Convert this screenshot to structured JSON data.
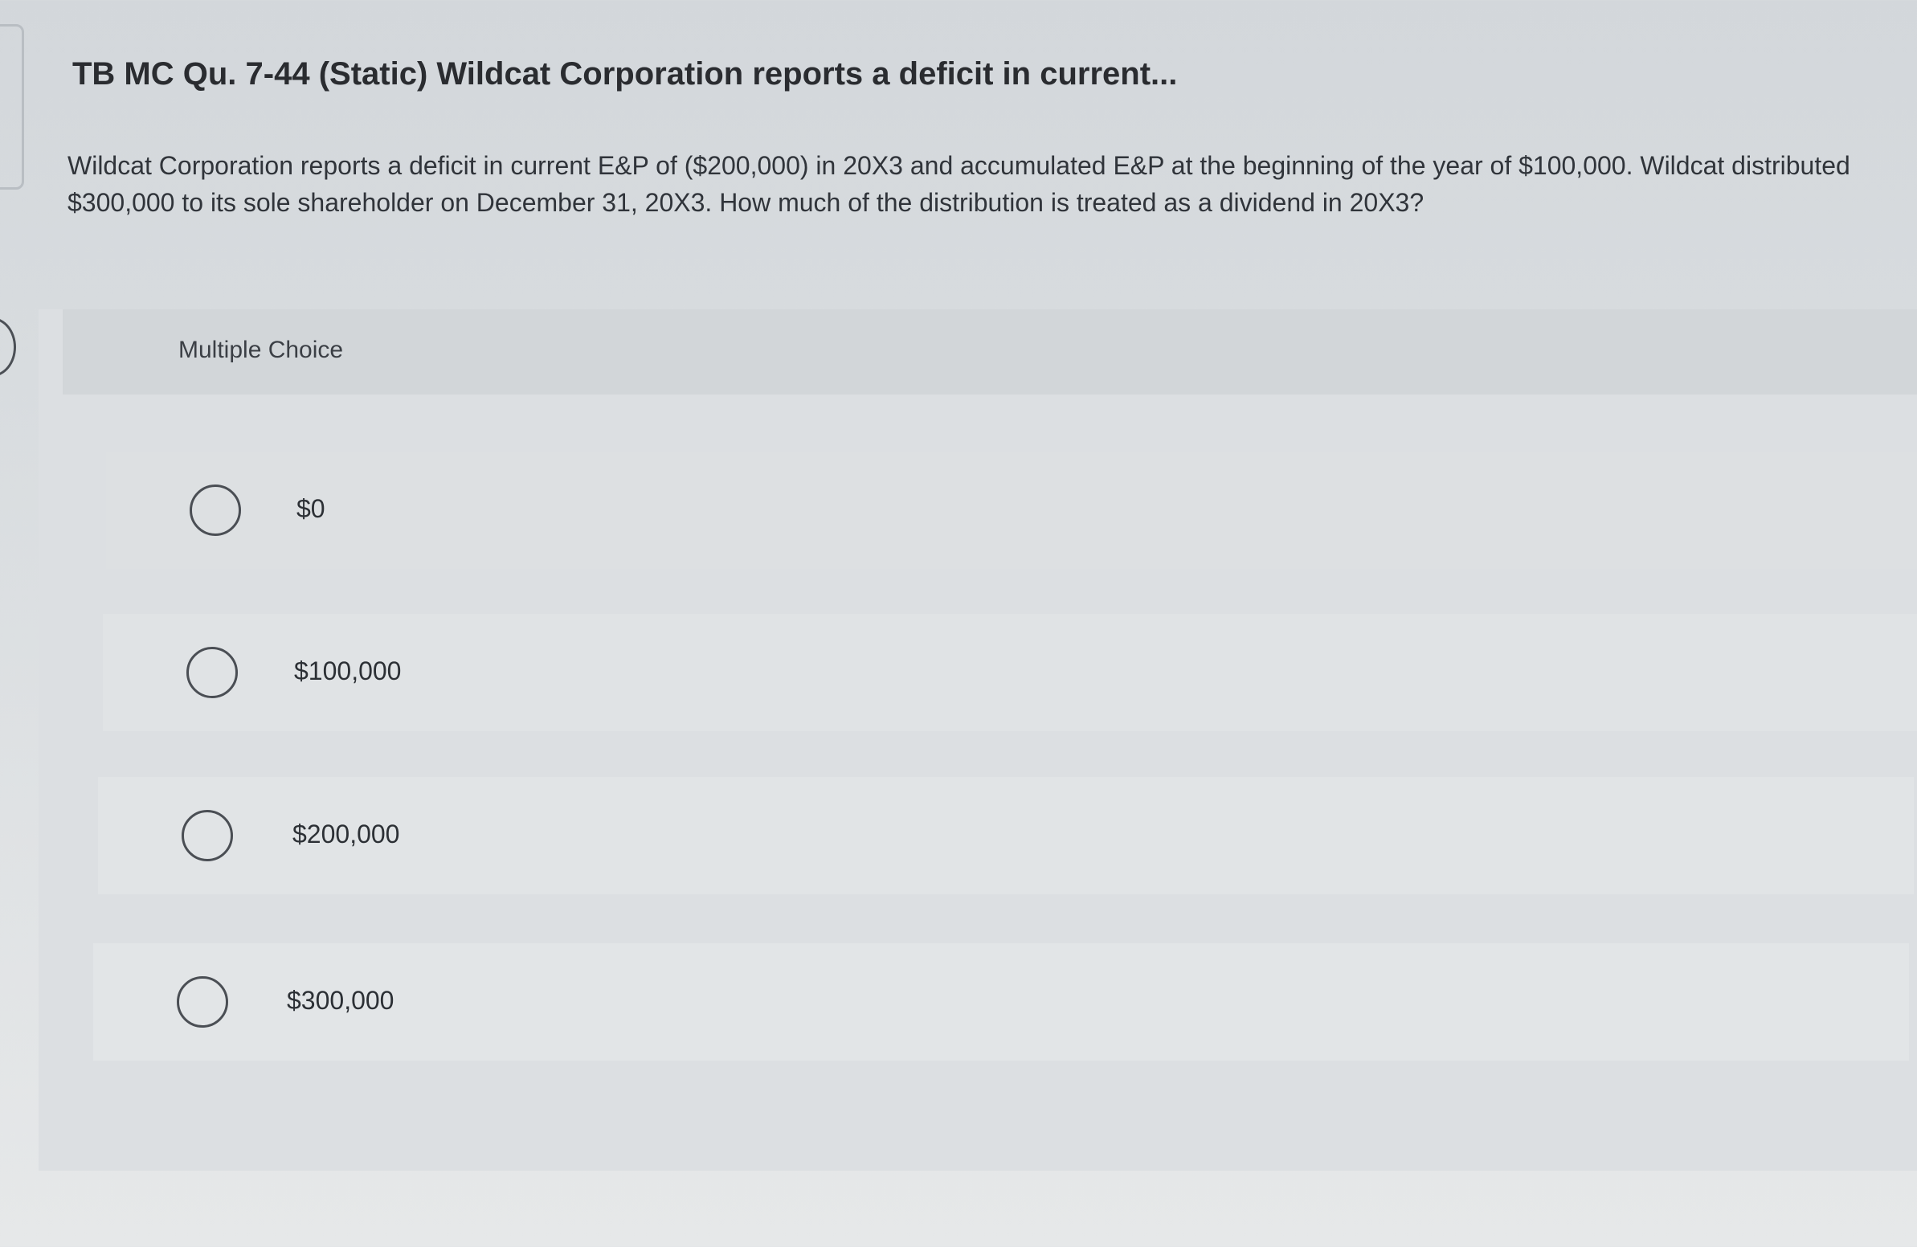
{
  "question": {
    "title": "TB MC Qu. 7-44 (Static) Wildcat Corporation reports a deficit in current...",
    "text": "Wildcat Corporation reports a deficit in current E&P of ($200,000) in 20X3 and accumulated E&P at the beginning of the year of $100,000. Wildcat distributed $300,000 to its sole shareholder on December 31, 20X3. How much of the distribution is treated as a dividend in 20X3?"
  },
  "choices": {
    "header": "Multiple Choice",
    "options": [
      {
        "label": "$0"
      },
      {
        "label": "$100,000"
      },
      {
        "label": "$200,000"
      },
      {
        "label": "$300,000"
      }
    ]
  },
  "icons": {
    "radio": "radio-button-unselected-icon"
  }
}
